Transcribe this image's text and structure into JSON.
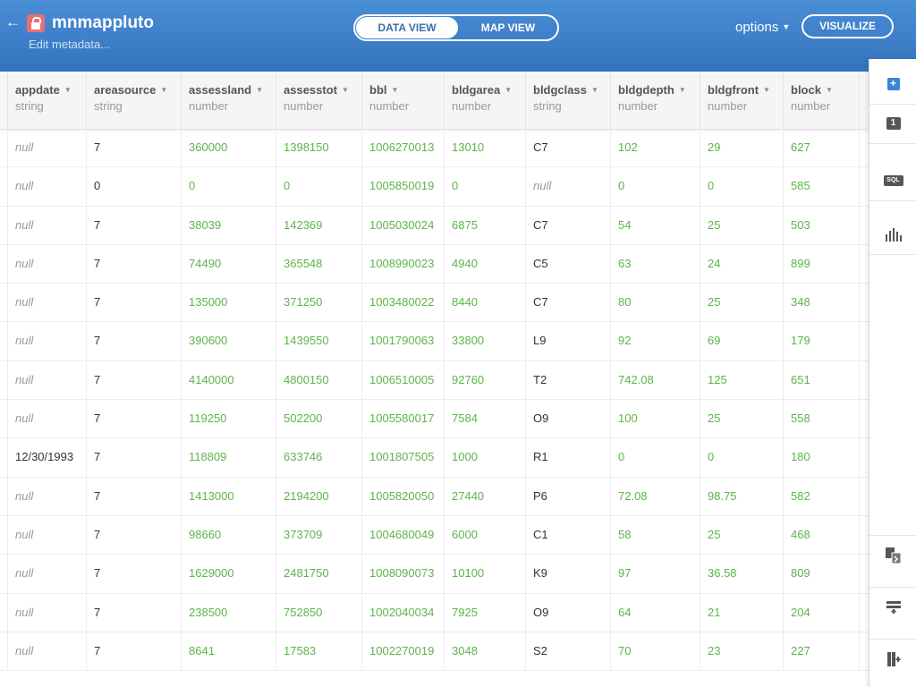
{
  "header": {
    "back_icon": "←",
    "title": "mnmappluto",
    "edit_metadata": "Edit metadata...",
    "tabs": {
      "data_view": "DATA VIEW",
      "map_view": "MAP VIEW"
    },
    "options": "options",
    "visualize": "VISUALIZE"
  },
  "columns": [
    {
      "name": "appdate",
      "type": "string"
    },
    {
      "name": "areasource",
      "type": "string"
    },
    {
      "name": "assessland",
      "type": "number"
    },
    {
      "name": "assesstot",
      "type": "number"
    },
    {
      "name": "bbl",
      "type": "number"
    },
    {
      "name": "bldgarea",
      "type": "number"
    },
    {
      "name": "bldgclass",
      "type": "string"
    },
    {
      "name": "bldgdepth",
      "type": "number"
    },
    {
      "name": "bldgfront",
      "type": "number"
    },
    {
      "name": "block",
      "type": "number"
    }
  ],
  "rows": [
    [
      "null",
      "7",
      "360000",
      "1398150",
      "1006270013",
      "13010",
      "C7",
      "102",
      "29",
      "627"
    ],
    [
      "null",
      "0",
      "0",
      "0",
      "1005850019",
      "0",
      "null",
      "0",
      "0",
      "585"
    ],
    [
      "null",
      "7",
      "38039",
      "142369",
      "1005030024",
      "6875",
      "C7",
      "54",
      "25",
      "503"
    ],
    [
      "null",
      "7",
      "74490",
      "365548",
      "1008990023",
      "4940",
      "C5",
      "63",
      "24",
      "899"
    ],
    [
      "null",
      "7",
      "135000",
      "371250",
      "1003480022",
      "8440",
      "C7",
      "80",
      "25",
      "348"
    ],
    [
      "null",
      "7",
      "390600",
      "1439550",
      "1001790063",
      "33800",
      "L9",
      "92",
      "69",
      "179"
    ],
    [
      "null",
      "7",
      "4140000",
      "4800150",
      "1006510005",
      "92760",
      "T2",
      "742.08",
      "125",
      "651"
    ],
    [
      "null",
      "7",
      "119250",
      "502200",
      "1005580017",
      "7584",
      "O9",
      "100",
      "25",
      "558"
    ],
    [
      "12/30/1993",
      "7",
      "118809",
      "633746",
      "1001807505",
      "1000",
      "R1",
      "0",
      "0",
      "180"
    ],
    [
      "null",
      "7",
      "1413000",
      "2194200",
      "1005820050",
      "27440",
      "P6",
      "72.08",
      "98.75",
      "582"
    ],
    [
      "null",
      "7",
      "98660",
      "373709",
      "1004680049",
      "6000",
      "C1",
      "58",
      "25",
      "468"
    ],
    [
      "null",
      "7",
      "1629000",
      "2481750",
      "1008090073",
      "10100",
      "K9",
      "97",
      "36.58",
      "809"
    ],
    [
      "null",
      "7",
      "238500",
      "752850",
      "1002040034",
      "7925",
      "O9",
      "64",
      "21",
      "204"
    ],
    [
      "null",
      "7",
      "8641",
      "17583",
      "1002270019",
      "3048",
      "S2",
      "70",
      "23",
      "227"
    ]
  ],
  "sidebar": {
    "add": "+",
    "one": "1",
    "sql": "SQL",
    "chart_icon": "bar-chart-icon",
    "merge_icon": "merge-icon",
    "add_row_icon": "add-row-icon",
    "add_column_icon": "add-column-icon"
  }
}
